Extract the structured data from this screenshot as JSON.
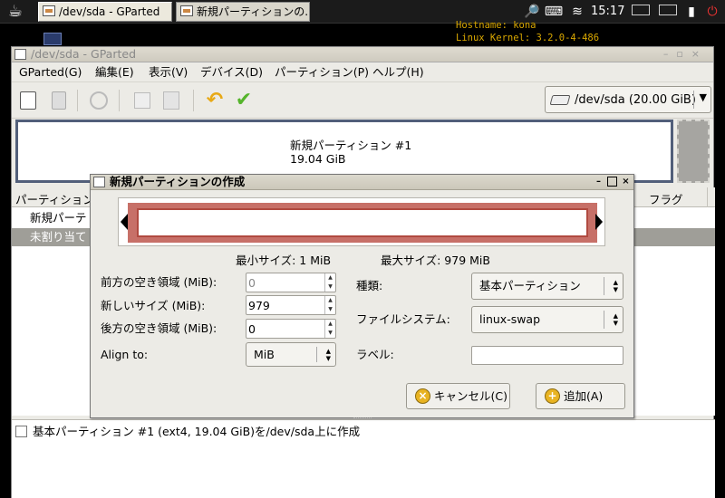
{
  "taskbar": {
    "tasks": [
      {
        "label": "/dev/sda - GParted"
      },
      {
        "label": "新規パーティションの..."
      }
    ],
    "clock": "15:17"
  },
  "conky": {
    "line1": "Hostname: kona",
    "line2": "Linux Kernel: 3.2.0-4-486"
  },
  "window": {
    "title": "/dev/sda - GParted",
    "menu": [
      "GParted(G)",
      "編集(E)",
      "表示(V)",
      "デバイス(D)",
      "パーティション(P)",
      "ヘルプ(H)"
    ],
    "device": "/dev/sda  (20.00 GiB)"
  },
  "diskmap": {
    "partition_name": "新規パーティション #1",
    "partition_size": "19.04 GiB"
  },
  "plist": {
    "col_partition": "パーティション",
    "col_flags": "フラグ",
    "rows": [
      {
        "name": "新規パーテ"
      },
      {
        "name": "未割り当て"
      }
    ]
  },
  "operations": {
    "item": "基本パーティション #1 (ext4, 19.04 GiB)を/dev/sda上に作成"
  },
  "dialog": {
    "title": "新規パーティションの作成",
    "min_size": "最小サイズ: 1 MiB",
    "max_size": "最大サイズ: 979 MiB",
    "free_before_label": "前方の空き領域 (MiB):",
    "free_before_value": "0",
    "new_size_label": "新しいサイズ (MiB):",
    "new_size_value": "979",
    "free_after_label": "後方の空き領域 (MiB):",
    "free_after_value": "0",
    "align_label": "Align to:",
    "align_value": "MiB",
    "type_label": "種類:",
    "type_value": "基本パーティション",
    "fs_label": "ファイルシステム:",
    "fs_value": "linux-swap",
    "label_label": "ラベル:",
    "label_value": "",
    "cancel": "キャンセル(C)",
    "add": "追加(A)"
  }
}
